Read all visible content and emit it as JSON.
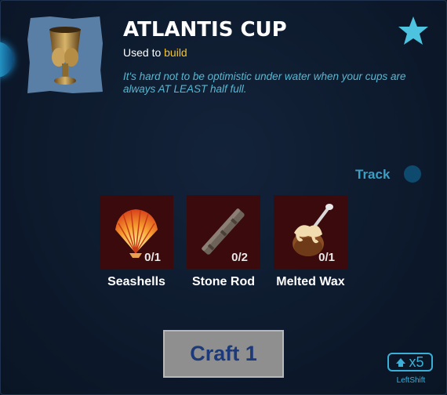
{
  "item": {
    "title": "ATLANTIS CUP",
    "used_prefix": "Used to ",
    "used_keyword": "build",
    "flavor": "It's hard not to be optimistic under water when your cups are always AT LEAST half full.",
    "icon": "goblet-icon"
  },
  "favorite": {
    "icon": "star-icon",
    "color": "#4ec3e0"
  },
  "track": {
    "label": "Track",
    "enabled": false
  },
  "ingredients": [
    {
      "name": "Seashells",
      "count": "0/1",
      "icon": "seashell-icon"
    },
    {
      "name": "Stone Rod",
      "count": "0/2",
      "icon": "stone-rod-icon"
    },
    {
      "name": "Melted Wax",
      "count": "0/1",
      "icon": "melted-wax-icon"
    }
  ],
  "craft": {
    "label": "Craft 1"
  },
  "bulk": {
    "multiplier": "x5",
    "key": "LeftShift",
    "icon": "shift-arrow-icon"
  },
  "colors": {
    "accent": "#3ab0d8",
    "keyword": "#f2c230",
    "flavor": "#56b8d2",
    "slot_bg": "#3a0a0c",
    "button_bg": "#8f8f8f",
    "button_text": "#1c3a7a"
  }
}
